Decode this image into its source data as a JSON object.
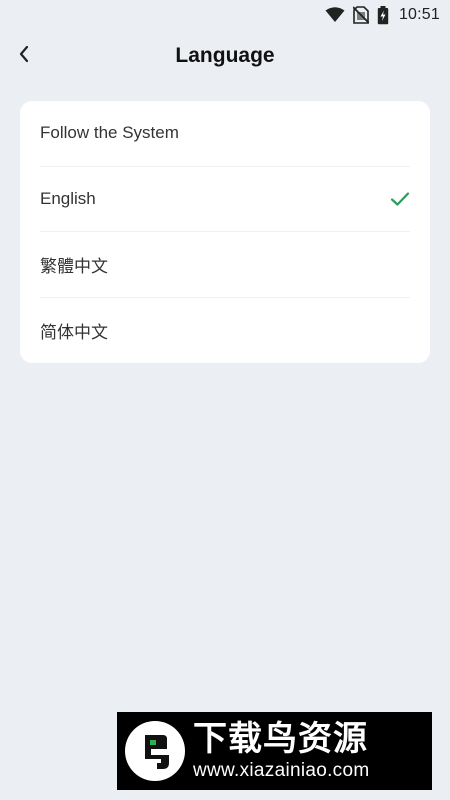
{
  "status_bar": {
    "time": "10:51",
    "icons": [
      "wifi-icon",
      "no-sim-icon",
      "battery-charging-icon"
    ]
  },
  "header": {
    "back_icon": "chevron-left-icon",
    "title": "Language"
  },
  "languages": [
    {
      "label": "Follow the System",
      "selected": false
    },
    {
      "label": "English",
      "selected": true
    },
    {
      "label": "繁體中文",
      "selected": false
    },
    {
      "label": "简体中文",
      "selected": false
    }
  ],
  "colors": {
    "background": "#ebeef2",
    "card": "#ffffff",
    "check": "#2e9b5a",
    "text": "#333333"
  },
  "watermark": {
    "name": "下载鸟资源",
    "url": "www.xiazainiao.com"
  }
}
